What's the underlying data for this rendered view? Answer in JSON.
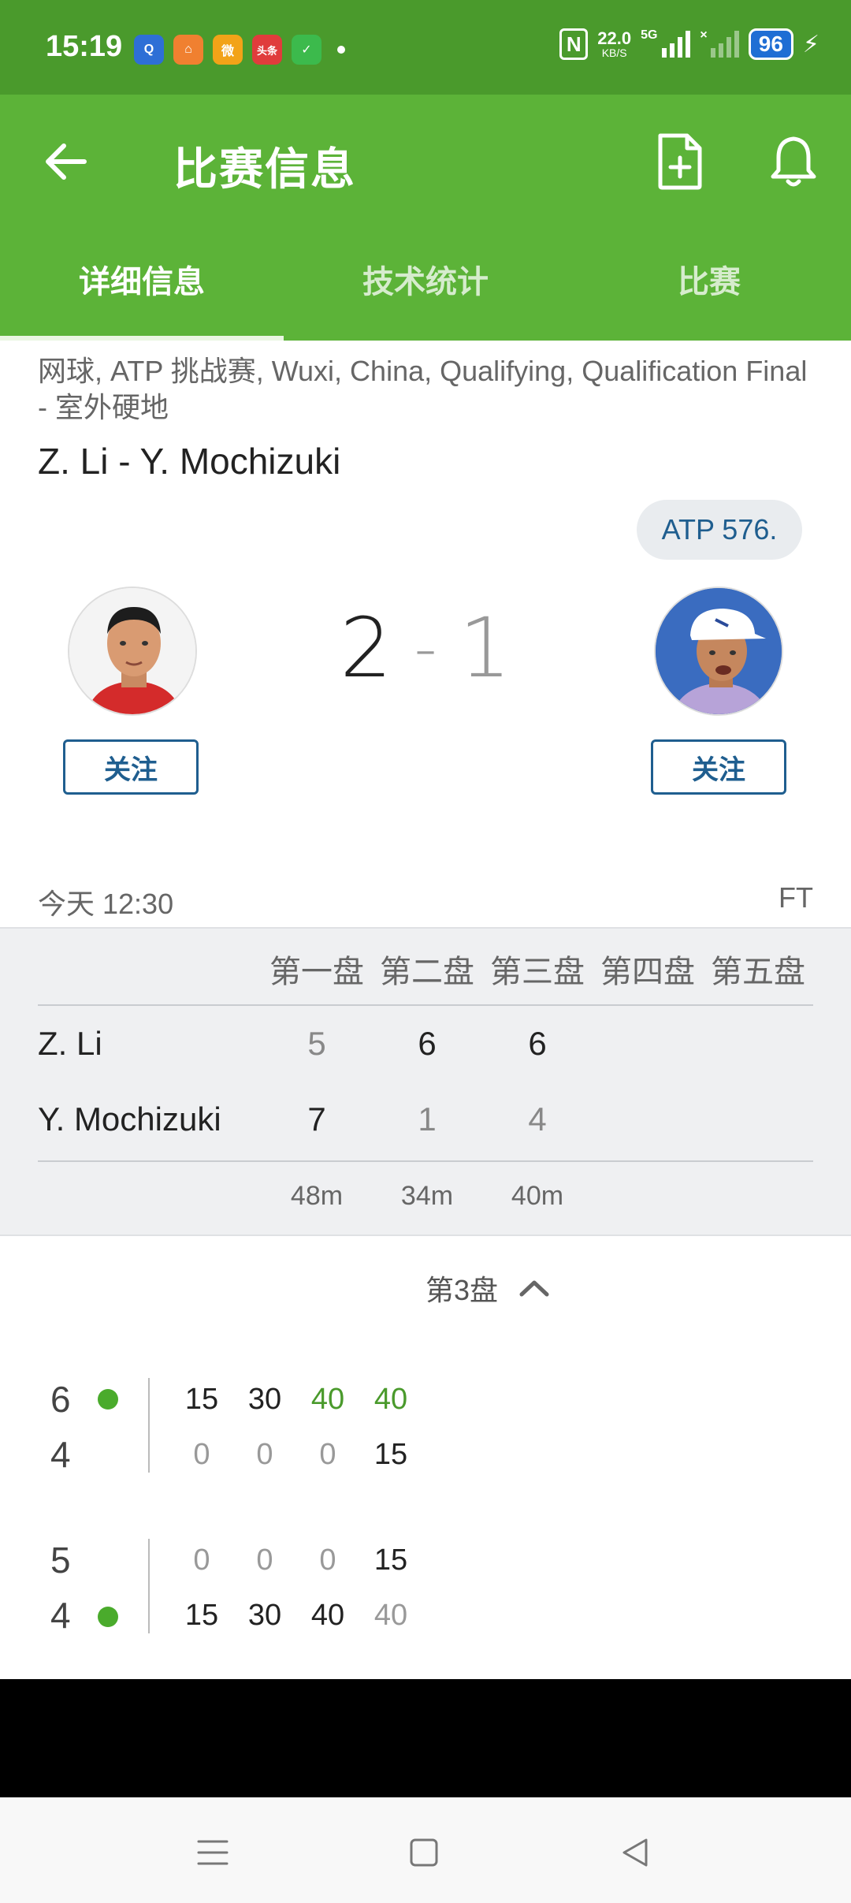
{
  "status_bar": {
    "time": "15:19",
    "apps": [
      {
        "icon": "news-app-icon",
        "label": "Q",
        "color": "#2e6fd6"
      },
      {
        "icon": "home-app-icon",
        "label": "⌂",
        "color": "#f08030"
      },
      {
        "icon": "weibo-app-icon",
        "label": "微",
        "color": "#f2a318"
      },
      {
        "icon": "toutiao-app-icon",
        "label": "头条",
        "color": "#e03c3c"
      },
      {
        "icon": "green-app-icon",
        "label": "✓",
        "color": "#3cba4c"
      }
    ],
    "network_speed": "22.0",
    "network_speed_unit": "KB/S",
    "network_type": "5G",
    "battery": "96"
  },
  "app_bar": {
    "title": "比赛信息"
  },
  "tabs": [
    {
      "label": "详细信息",
      "active": true
    },
    {
      "label": "技术统计",
      "active": false
    },
    {
      "label": "比赛",
      "active": false
    }
  ],
  "match": {
    "meta": "网球, ATP 挑战赛, Wuxi, China, Qualifying, Qualification Final - 室外硬地",
    "title": "Z. Li - Y. Mochizuki",
    "rank_badge": "ATP 576.",
    "score_home": "2",
    "score_sep": "-",
    "score_away": "1",
    "follow_label": "关注",
    "start_time": "今天 12:30",
    "status": "FT"
  },
  "sets_table": {
    "headers": [
      "第一盘",
      "第二盘",
      "第三盘",
      "第四盘",
      "第五盘"
    ],
    "players": [
      {
        "name": "Z. Li",
        "scores": [
          "5",
          "6",
          "6"
        ]
      },
      {
        "name": "Y. Mochizuki",
        "scores": [
          "7",
          "1",
          "4"
        ]
      }
    ],
    "durations": [
      "48m",
      "34m",
      "40m"
    ]
  },
  "set_selector": {
    "label": "第3盘"
  },
  "point_by_point": [
    {
      "top": {
        "games": "6",
        "serving": true,
        "points": [
          "15",
          "30",
          "40",
          "40"
        ]
      },
      "bottom": {
        "games": "4",
        "serving": false,
        "points": [
          "0",
          "0",
          "0",
          "15"
        ]
      }
    },
    {
      "top": {
        "games": "5",
        "serving": false,
        "points": [
          "0",
          "0",
          "0",
          "15"
        ]
      },
      "bottom": {
        "games": "4",
        "serving": true,
        "points": [
          "15",
          "30",
          "40",
          "40"
        ]
      }
    }
  ],
  "colors": {
    "status_bar": "#4a9a2c",
    "app_bar": "#5cb338",
    "accent_blue": "#1f5e8f",
    "serve_dot": "#4aab2c"
  }
}
